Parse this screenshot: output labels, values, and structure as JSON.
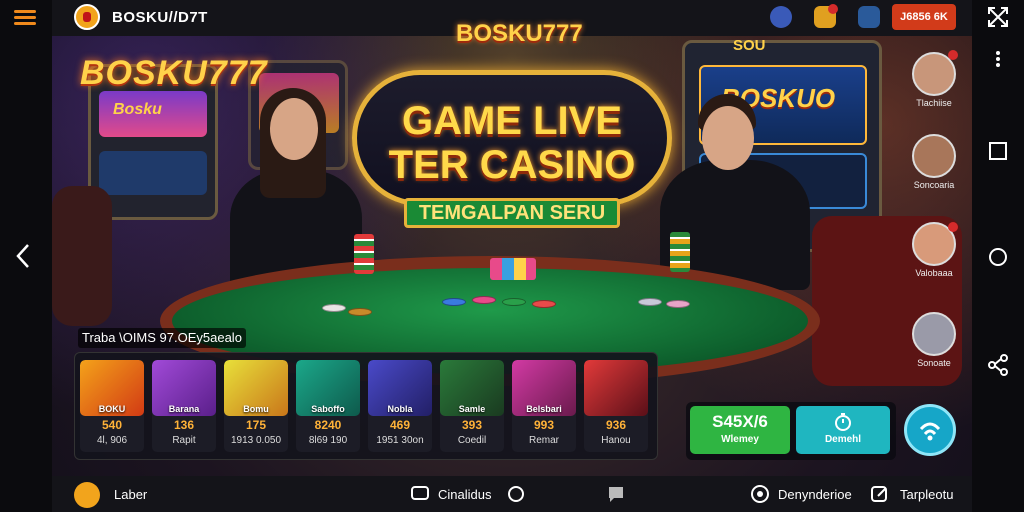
{
  "topbar": {
    "title": "BOSKU//D7T",
    "balance": "J6856 6K",
    "badge_count": "1"
  },
  "scene": {
    "brand_left": "BOSKU777",
    "brand_top": "BOSKU777",
    "headline_line1": "GAME LIVE",
    "headline_line2": "TER CASINO",
    "ribbon": "TEMGALPAN SERU",
    "slot_right_text": "BOSKUO",
    "slot_left_text": "Bosku",
    "slot_top_text": "SOU"
  },
  "games": {
    "strip_label": "Traba \\OIMS 97.OEy5aealo",
    "cards": [
      {
        "name": "BOKU",
        "value": "540",
        "sub": "4l, 906",
        "colors": [
          "#f4a21a",
          "#d23a14"
        ]
      },
      {
        "name": "Barana",
        "value": "136",
        "sub": "Rapit",
        "colors": [
          "#a14ad8",
          "#5a1f8a"
        ]
      },
      {
        "name": "Bomu",
        "value": "175",
        "sub": "1913 0.050",
        "colors": [
          "#e8e03a",
          "#c9761a"
        ]
      },
      {
        "name": "Saboffo",
        "value": "8240",
        "sub": "8l69 190",
        "colors": [
          "#1ba88a",
          "#0e5a4c"
        ]
      },
      {
        "name": "Nobla",
        "value": "469",
        "sub": "1951 30on",
        "colors": [
          "#4a4ac9",
          "#221f66"
        ]
      },
      {
        "name": "Samle",
        "value": "393",
        "sub": "Coedil",
        "colors": [
          "#2a7a3a",
          "#1a3a20"
        ]
      },
      {
        "name": "Belsbari",
        "value": "993",
        "sub": "Remar",
        "colors": [
          "#d23aa4",
          "#6a1a4c"
        ]
      },
      {
        "name": "",
        "value": "936",
        "sub": "Hanou",
        "colors": [
          "#e23a3a",
          "#5a0f18"
        ]
      }
    ]
  },
  "actions": {
    "primary_value": "S45X/6",
    "primary_label": "Wlemey",
    "secondary_label": "Demehl"
  },
  "players": [
    {
      "label": "Tlachiise"
    },
    {
      "label": "Soncoaria"
    },
    {
      "label": "Valobaaa"
    },
    {
      "label": "Sonoate"
    }
  ],
  "bottombar": {
    "left_label": "Laber",
    "mid_label": "Cinalidus",
    "right1_label": "Denynderioe",
    "right2_label": "Tarpleotu"
  },
  "colors": {
    "accent_orange": "#f08a1c",
    "gold": "#ffd24a",
    "felt_green": "#1f9a4a",
    "primary_button": "#2fb542",
    "secondary_button": "#1fb6c0"
  }
}
